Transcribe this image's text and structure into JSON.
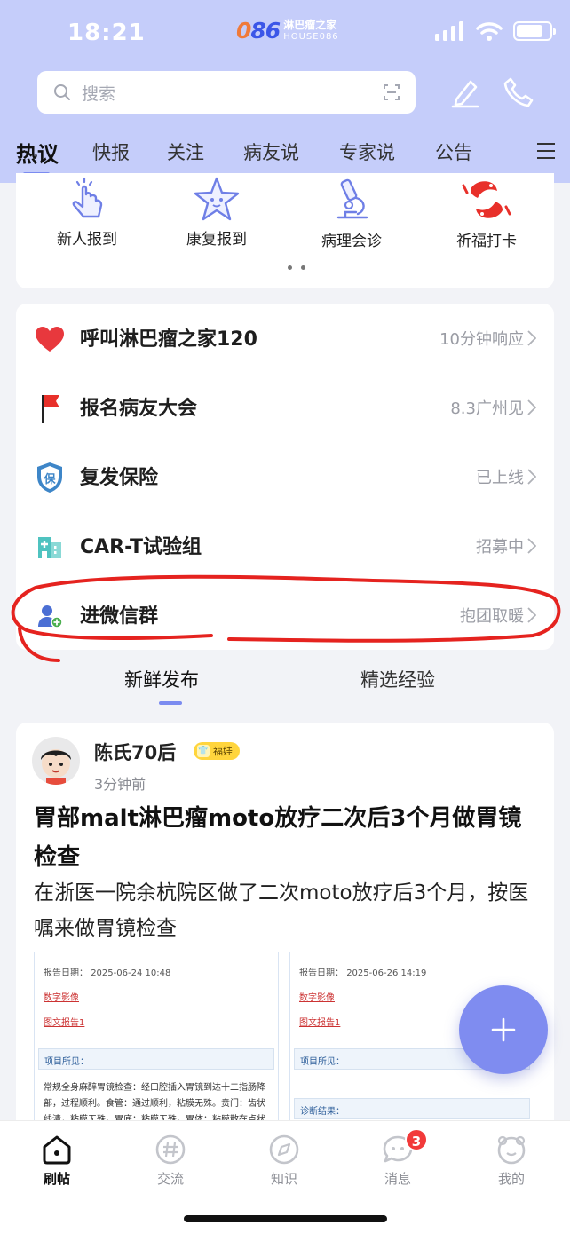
{
  "status_bar": {
    "time": "18:21"
  },
  "logo": {
    "mark_a": "0",
    "mark_b": "86",
    "name": "淋巴瘤之家",
    "sub": "HOUSE086"
  },
  "search": {
    "placeholder": "搜索"
  },
  "tabs": [
    {
      "label": "热议",
      "active": true
    },
    {
      "label": "快报"
    },
    {
      "label": "关注"
    },
    {
      "label": "病友说"
    },
    {
      "label": "专家说"
    },
    {
      "label": "公告"
    }
  ],
  "quick_actions": [
    {
      "label": "新人报到",
      "icon": "tap-hand-icon"
    },
    {
      "label": "康复报到",
      "icon": "recovery-star-icon"
    },
    {
      "label": "病理会诊",
      "icon": "microscope-icon"
    },
    {
      "label": "祈福打卡",
      "icon": "koi-fish-icon"
    }
  ],
  "menu_items": [
    {
      "title": "呼叫淋巴瘤之家120",
      "sub": "10分钟响应",
      "icon": "heart-icon"
    },
    {
      "title": "报名病友大会",
      "sub": "8.3广州见",
      "icon": "red-flag-icon"
    },
    {
      "title": "复发保险",
      "sub": "已上线",
      "icon": "insurance-shield-icon"
    },
    {
      "title": "CAR-T试验组",
      "sub": "招募中",
      "icon": "hospital-icon"
    },
    {
      "title": "进微信群",
      "sub": "抱团取暖",
      "icon": "group-add-icon"
    }
  ],
  "sub_tabs": [
    {
      "label": "新鲜发布",
      "active": true
    },
    {
      "label": "精选经验"
    }
  ],
  "post": {
    "author": "陈氏70后",
    "badge": "福娃",
    "time": "3分钟前",
    "title": "胃部malt淋巴瘤moto放疗二次后3个月做胃镜检查",
    "body": "在浙医一院余杭院区做了二次moto放疗后3个月，按医嘱来做胃镜检查",
    "images": [
      {
        "date_label": "报告日期：",
        "date": "2025-06-24 10:48",
        "link1": "数字影像",
        "link2": "图文报告1",
        "section1": "项目所见：",
        "text": "常规全身麻醉胃镜检查：经口腔插入胃镜到达十二指肠降部，过程顺利。食管：通过顺利，粘膜无殊。贲门：齿状线清，粘膜无殊。胃底：粘膜无殊。胃体：粘膜散在点状"
      },
      {
        "date_label": "报告日期：",
        "date": "2025-06-26 14:19",
        "link1": "数字影像",
        "link2": "图文报告1",
        "section1": "项目所见：",
        "section2": "诊断结果："
      }
    ]
  },
  "bottom_nav": [
    {
      "label": "刷帖",
      "icon": "home-icon",
      "active": true
    },
    {
      "label": "交流",
      "icon": "hashtag-icon"
    },
    {
      "label": "知识",
      "icon": "compass-icon"
    },
    {
      "label": "消息",
      "icon": "chat-icon",
      "badge": "3"
    },
    {
      "label": "我的",
      "icon": "profile-face-icon"
    }
  ],
  "colors": {
    "header_bg": "#c5cdfa",
    "accent": "#7b8bf0",
    "fab": "#7f8cf0",
    "badge_red": "#f23a3a"
  }
}
